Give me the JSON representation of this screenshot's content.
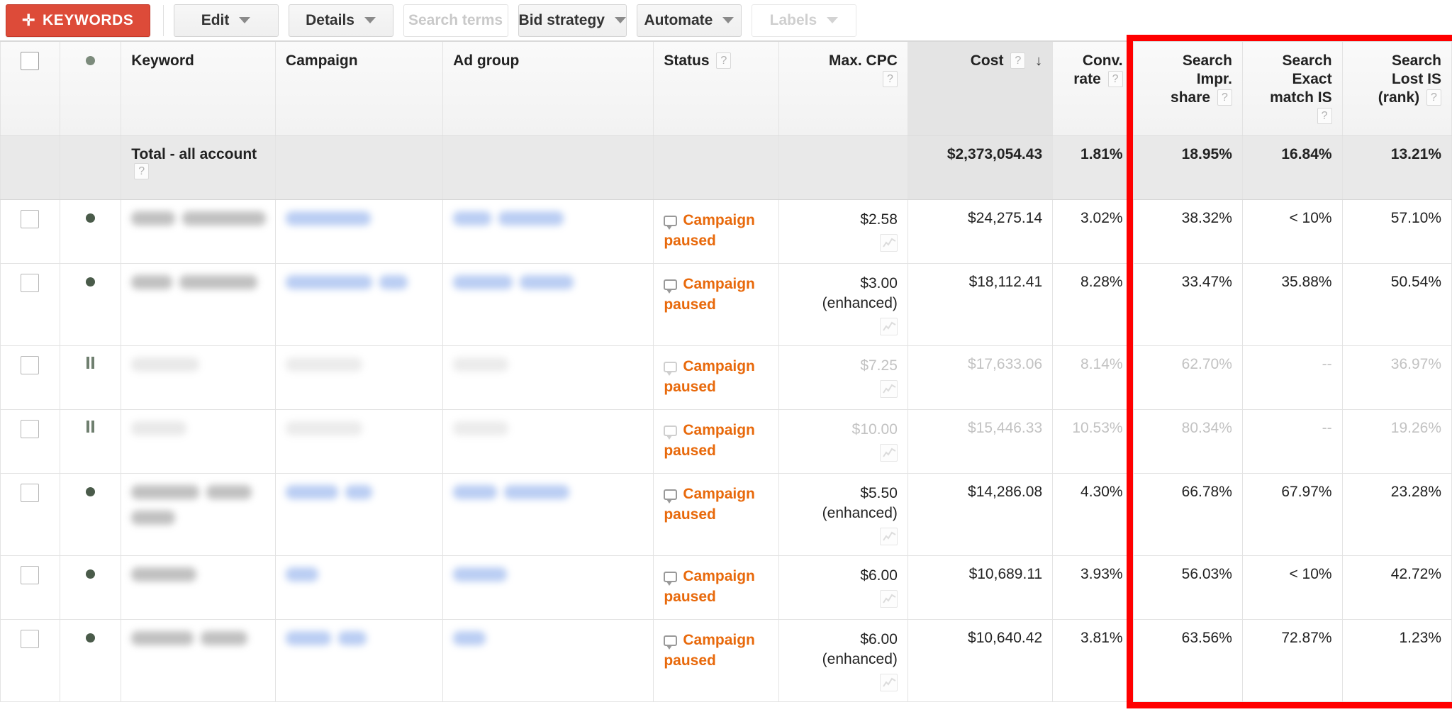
{
  "toolbar": {
    "keywords_button": "KEYWORDS",
    "plus_glyph": "✛",
    "edit": "Edit",
    "details": "Details",
    "search_terms": "Search terms",
    "bid_strategy": "Bid strategy",
    "automate": "Automate",
    "labels": "Labels",
    "accent_color": "#dd4b39"
  },
  "highlight": {
    "color": "#ff0000",
    "note": "red rectangle around the three search impression share columns"
  },
  "table": {
    "help_glyph": "?",
    "sort_glyph": "↓",
    "headers": {
      "keyword": "Keyword",
      "campaign": "Campaign",
      "ad_group": "Ad group",
      "status": "Status",
      "max_cpc_l1": "Max. CPC",
      "cost": "Cost",
      "conv_l1": "Conv.",
      "conv_l2": "rate",
      "sis_l1": "Search",
      "sis_l2": "Impr.",
      "sis_l3": "share",
      "sem_l1": "Search",
      "sem_l2": "Exact",
      "sem_l3": "match IS",
      "slir_l1": "Search",
      "slir_l2": "Lost IS",
      "slir_l3": "(rank)"
    },
    "total_row": {
      "label": "Total - all account",
      "cost": "$2,373,054.43",
      "conv_rate": "1.81%",
      "search_impr_share": "18.95%",
      "search_exact_match_is": "16.84%",
      "search_lost_is_rank": "13.21%"
    },
    "status_label": "Campaign paused",
    "enhanced_label": "(enhanced)",
    "rows": [
      {
        "state": "active",
        "state_icon": "dot",
        "max_cpc": "$2.58",
        "enhanced": false,
        "cost": "$24,275.14",
        "conv_rate": "3.02%",
        "search_impr_share": "38.32%",
        "search_exact_match_is": "< 10%",
        "search_lost_is_rank": "57.10%"
      },
      {
        "state": "active",
        "state_icon": "dot",
        "max_cpc": "$3.00",
        "enhanced": true,
        "cost": "$18,112.41",
        "conv_rate": "8.28%",
        "search_impr_share": "33.47%",
        "search_exact_match_is": "35.88%",
        "search_lost_is_rank": "50.54%"
      },
      {
        "state": "paused",
        "state_icon": "pause",
        "max_cpc": "$7.25",
        "enhanced": false,
        "cost": "$17,633.06",
        "conv_rate": "8.14%",
        "search_impr_share": "62.70%",
        "search_exact_match_is": "--",
        "search_lost_is_rank": "36.97%"
      },
      {
        "state": "paused",
        "state_icon": "pause",
        "max_cpc": "$10.00",
        "enhanced": false,
        "cost": "$15,446.33",
        "conv_rate": "10.53%",
        "search_impr_share": "80.34%",
        "search_exact_match_is": "--",
        "search_lost_is_rank": "19.26%"
      },
      {
        "state": "active",
        "state_icon": "dot",
        "max_cpc": "$5.50",
        "enhanced": true,
        "cost": "$14,286.08",
        "conv_rate": "4.30%",
        "search_impr_share": "66.78%",
        "search_exact_match_is": "67.97%",
        "search_lost_is_rank": "23.28%"
      },
      {
        "state": "active",
        "state_icon": "dot",
        "max_cpc": "$6.00",
        "enhanced": false,
        "cost": "$10,689.11",
        "conv_rate": "3.93%",
        "search_impr_share": "56.03%",
        "search_exact_match_is": "< 10%",
        "search_lost_is_rank": "42.72%"
      },
      {
        "state": "active",
        "state_icon": "dot",
        "max_cpc": "$6.00",
        "enhanced": true,
        "cost": "$10,640.42",
        "conv_rate": "3.81%",
        "search_impr_share": "63.56%",
        "search_exact_match_is": "72.87%",
        "search_lost_is_rank": "1.23%"
      }
    ]
  }
}
